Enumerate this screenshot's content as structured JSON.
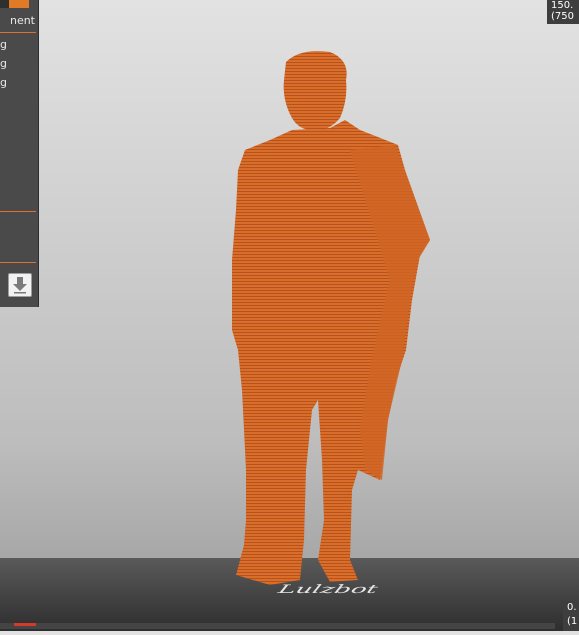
{
  "panel": {
    "header_text": "nent",
    "rows": [
      "g",
      "g",
      "g"
    ]
  },
  "top_right_tab": {
    "line1": "150.",
    "line2": "(750"
  },
  "bottom_right_tab": {
    "line1": "0.",
    "line2": "(1"
  },
  "build_plate": {
    "logo_text": "Lulzbot"
  },
  "colors": {
    "accent": "#e07a26",
    "model": "#d86a28",
    "panel": "#4a4a4a"
  },
  "icons": {
    "download": "download-arrow-icon"
  }
}
